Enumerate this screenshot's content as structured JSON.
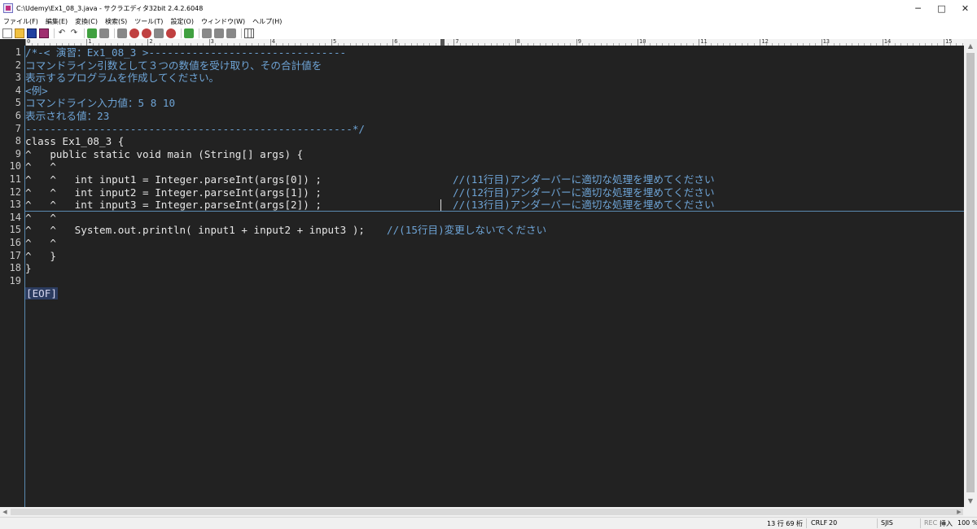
{
  "window": {
    "title": "C:\\Udemy\\Ex1_08_3.java - サクラエディタ32bit 2.4.2.6048",
    "minimize": "─",
    "maximize": "□",
    "close": "✕"
  },
  "menu": [
    "ファイル(F)",
    "編集(E)",
    "変換(C)",
    "検索(S)",
    "ツール(T)",
    "設定(O)",
    "ウィンドウ(W)",
    "ヘルプ(H)"
  ],
  "toolbar": [
    "new-file-icon",
    "open-file-icon",
    "save-icon",
    "save-all-icon",
    "undo-icon",
    "redo-icon",
    "jump-back-icon",
    "jump-forward-icon",
    "search-icon",
    "search-next-icon",
    "search-prev-icon",
    "grep-icon",
    "replace-icon",
    "compare-icon",
    "outline-icon",
    "settings-icon"
  ],
  "ruler": {
    "labels": [
      "0",
      "1",
      "2",
      "3",
      "4",
      "5",
      "6",
      "7",
      "8",
      "9",
      "10",
      "11",
      "12",
      "13",
      "14",
      "15"
    ]
  },
  "editor": {
    "line_numbers": [
      "1",
      "2",
      "3",
      "4",
      "5",
      "6",
      "7",
      "8",
      "9",
      "10",
      "11",
      "12",
      "13",
      "14",
      "15",
      "16",
      "17",
      "18",
      "19"
    ],
    "lines": [
      {
        "text": "/*-< 演習：Ex1_08_3 >--------------------------------",
        "kind": "comment"
      },
      {
        "text": "コマンドライン引数として３つの数値を受け取り、その合計値を",
        "kind": "comment"
      },
      {
        "text": "表示するプログラムを作成してください。",
        "kind": "comment"
      },
      {
        "text": "<例>",
        "kind": "comment"
      },
      {
        "text": "コマンドライン入力値：5 8 10",
        "kind": "comment"
      },
      {
        "text": "表示される値：23",
        "kind": "comment"
      },
      {
        "text": "-----------------------------------------------------*/",
        "kind": "comment"
      },
      {
        "text": "class Ex1_08_3 {",
        "kind": "code"
      },
      {
        "text": "^   public static void main (String[] args) {",
        "kind": "code"
      },
      {
        "text": "^   ^",
        "kind": "code"
      },
      {
        "text": "^   ^   int input1 = Integer.parseInt(args[0]) ;",
        "kind": "code",
        "comment": "//(11行目)アンダーバーに適切な処理を埋めてください"
      },
      {
        "text": "^   ^   int input2 = Integer.parseInt(args[1]) ;",
        "kind": "code",
        "comment": "//(12行目)アンダーバーに適切な処理を埋めてください"
      },
      {
        "text": "^   ^   int input3 = Integer.parseInt(args[2]) ;",
        "kind": "code",
        "comment": "//(13行目)アンダーバーに適切な処理を埋めてください"
      },
      {
        "text": "^   ^",
        "kind": "code"
      },
      {
        "text": "^   ^   System.out.println( input1 + input2 + input3 );",
        "kind": "code",
        "comment": "//(15行目)変更しないでください"
      },
      {
        "text": "^   ^",
        "kind": "code"
      },
      {
        "text": "^   }",
        "kind": "code"
      },
      {
        "text": "}",
        "kind": "code"
      },
      {
        "text": "",
        "kind": "code"
      }
    ],
    "eof": "[EOF]"
  },
  "status": {
    "position": "13 行  69 桁",
    "newline": "CRLF",
    "code": "20",
    "encoding": "SJIS",
    "rec": "REC",
    "mode": "挿入",
    "zoom": "100 %"
  }
}
